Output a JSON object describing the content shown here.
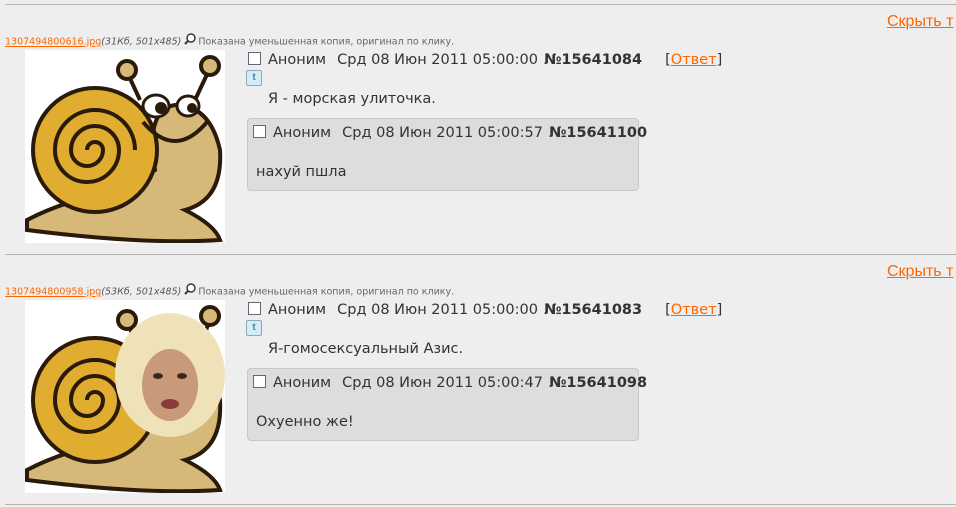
{
  "hide_label": "Скрыть т",
  "posts": [
    {
      "file_name": "1307494800616.jpg",
      "file_meta": "(31Кб, 501x485)",
      "thumb_note": "Показана уменьшенная копия, оригинал по клику.",
      "name": "Аноним",
      "date": "Срд 08 Июн 2011 05:00:00",
      "number": "№15641084",
      "reply_label": "Ответ",
      "text": "Я - морская улиточка.",
      "reply": {
        "name": "Аноним",
        "date": "Срд 08 Июн 2011 05:00:57",
        "number": "№15641100",
        "text": "нахуй пшла"
      }
    },
    {
      "file_name": "1307494800958.jpg",
      "file_meta": "(53Кб, 501x485)",
      "thumb_note": "Показана уменьшенная копия, оригинал по клику.",
      "name": "Аноним",
      "date": "Срд 08 Июн 2011 05:00:00",
      "number": "№15641083",
      "reply_label": "Ответ",
      "text": "Я-гомосексуальный Азис.",
      "reply": {
        "name": "Аноним",
        "date": "Срд 08 Июн 2011 05:00:47",
        "number": "№15641098",
        "text": "Охуенно же!"
      }
    }
  ]
}
